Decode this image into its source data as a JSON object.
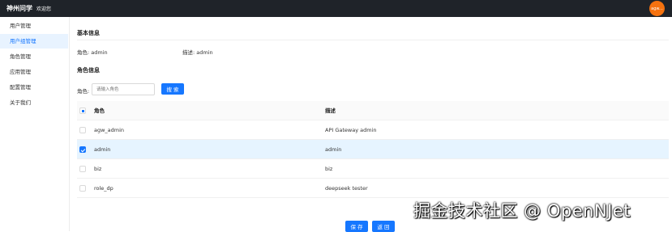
{
  "header": {
    "brand": "神州问学",
    "welcome": "欢迎您",
    "avatar_text": "agw..."
  },
  "sidebar": {
    "items": [
      {
        "label": "用户管理",
        "active": false
      },
      {
        "label": "用户组管理",
        "active": true
      },
      {
        "label": "角色管理",
        "active": false
      },
      {
        "label": "应用管理",
        "active": false
      },
      {
        "label": "配置管理",
        "active": false
      },
      {
        "label": "关于我们",
        "active": false
      }
    ]
  },
  "basic_info": {
    "title": "基本信息",
    "role_label": "角色: admin",
    "desc_label": "描述: admin"
  },
  "role_info": {
    "title": "角色信息",
    "filter_label": "角色:",
    "filter_placeholder": "请输入角色",
    "search_button": "搜 索"
  },
  "table": {
    "headers": {
      "role": "角色",
      "description": "描述"
    },
    "rows": [
      {
        "role": "agw_admin",
        "description": "API Gateway admin",
        "checked": false
      },
      {
        "role": "admin",
        "description": "admin",
        "checked": true
      },
      {
        "role": "biz",
        "description": "biz",
        "checked": false
      },
      {
        "role": "role_dp",
        "description": "deepseek tester",
        "checked": false
      }
    ]
  },
  "footer": {
    "save_button": "保 存",
    "back_button": "返 回"
  },
  "watermark": "掘金技术社区 @ OpenNJet",
  "colors": {
    "topbar": "#1f2329",
    "accent": "#1677ff",
    "avatar": "#f5720f",
    "selected_row": "#e6f4ff",
    "active_nav": "#e8f3ff"
  }
}
